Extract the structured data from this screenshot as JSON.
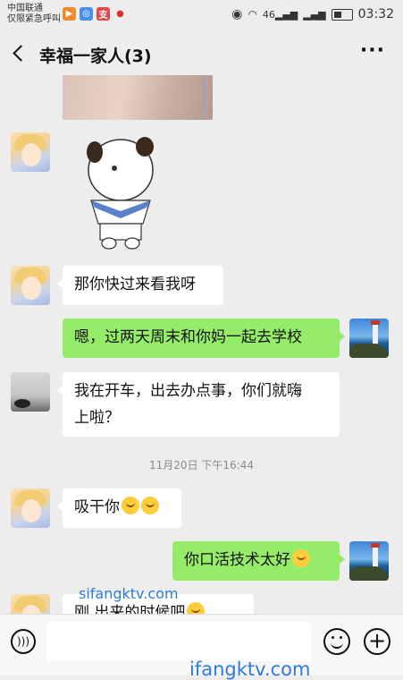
{
  "status_bar": {
    "carrier_line1": "中国联通",
    "carrier_line2": "仅限紧急呼叫",
    "signal_label": "46",
    "time": "03:32"
  },
  "header": {
    "title": "幸福一家人(3)",
    "more": "···"
  },
  "messages": [
    {
      "side": "left",
      "text": "那你快过来看我呀"
    },
    {
      "side": "right",
      "text": "嗯，过两天周末和你妈一起去学校"
    },
    {
      "side": "left",
      "text_line1": "我在开车，出去办点事，你们就嗨",
      "text_line2": "上啦？"
    },
    {
      "side": "left",
      "text": "吸干你"
    },
    {
      "side": "right",
      "text": "你口活技术太好"
    },
    {
      "side": "left",
      "text": "刚 出来的时候吧"
    }
  ],
  "timestamp": "11月20日 下午16:44",
  "watermarks": [
    "sifangktv.com",
    "ifangktv.com"
  ],
  "colors": {
    "background": "#ededed",
    "bubble_right": "#95ec69",
    "bubble_left": "#ffffff",
    "watermark": "#2b7be0"
  },
  "icons": [
    "back-icon",
    "more-icon",
    "voice-icon",
    "emoji-icon",
    "plus-icon"
  ]
}
